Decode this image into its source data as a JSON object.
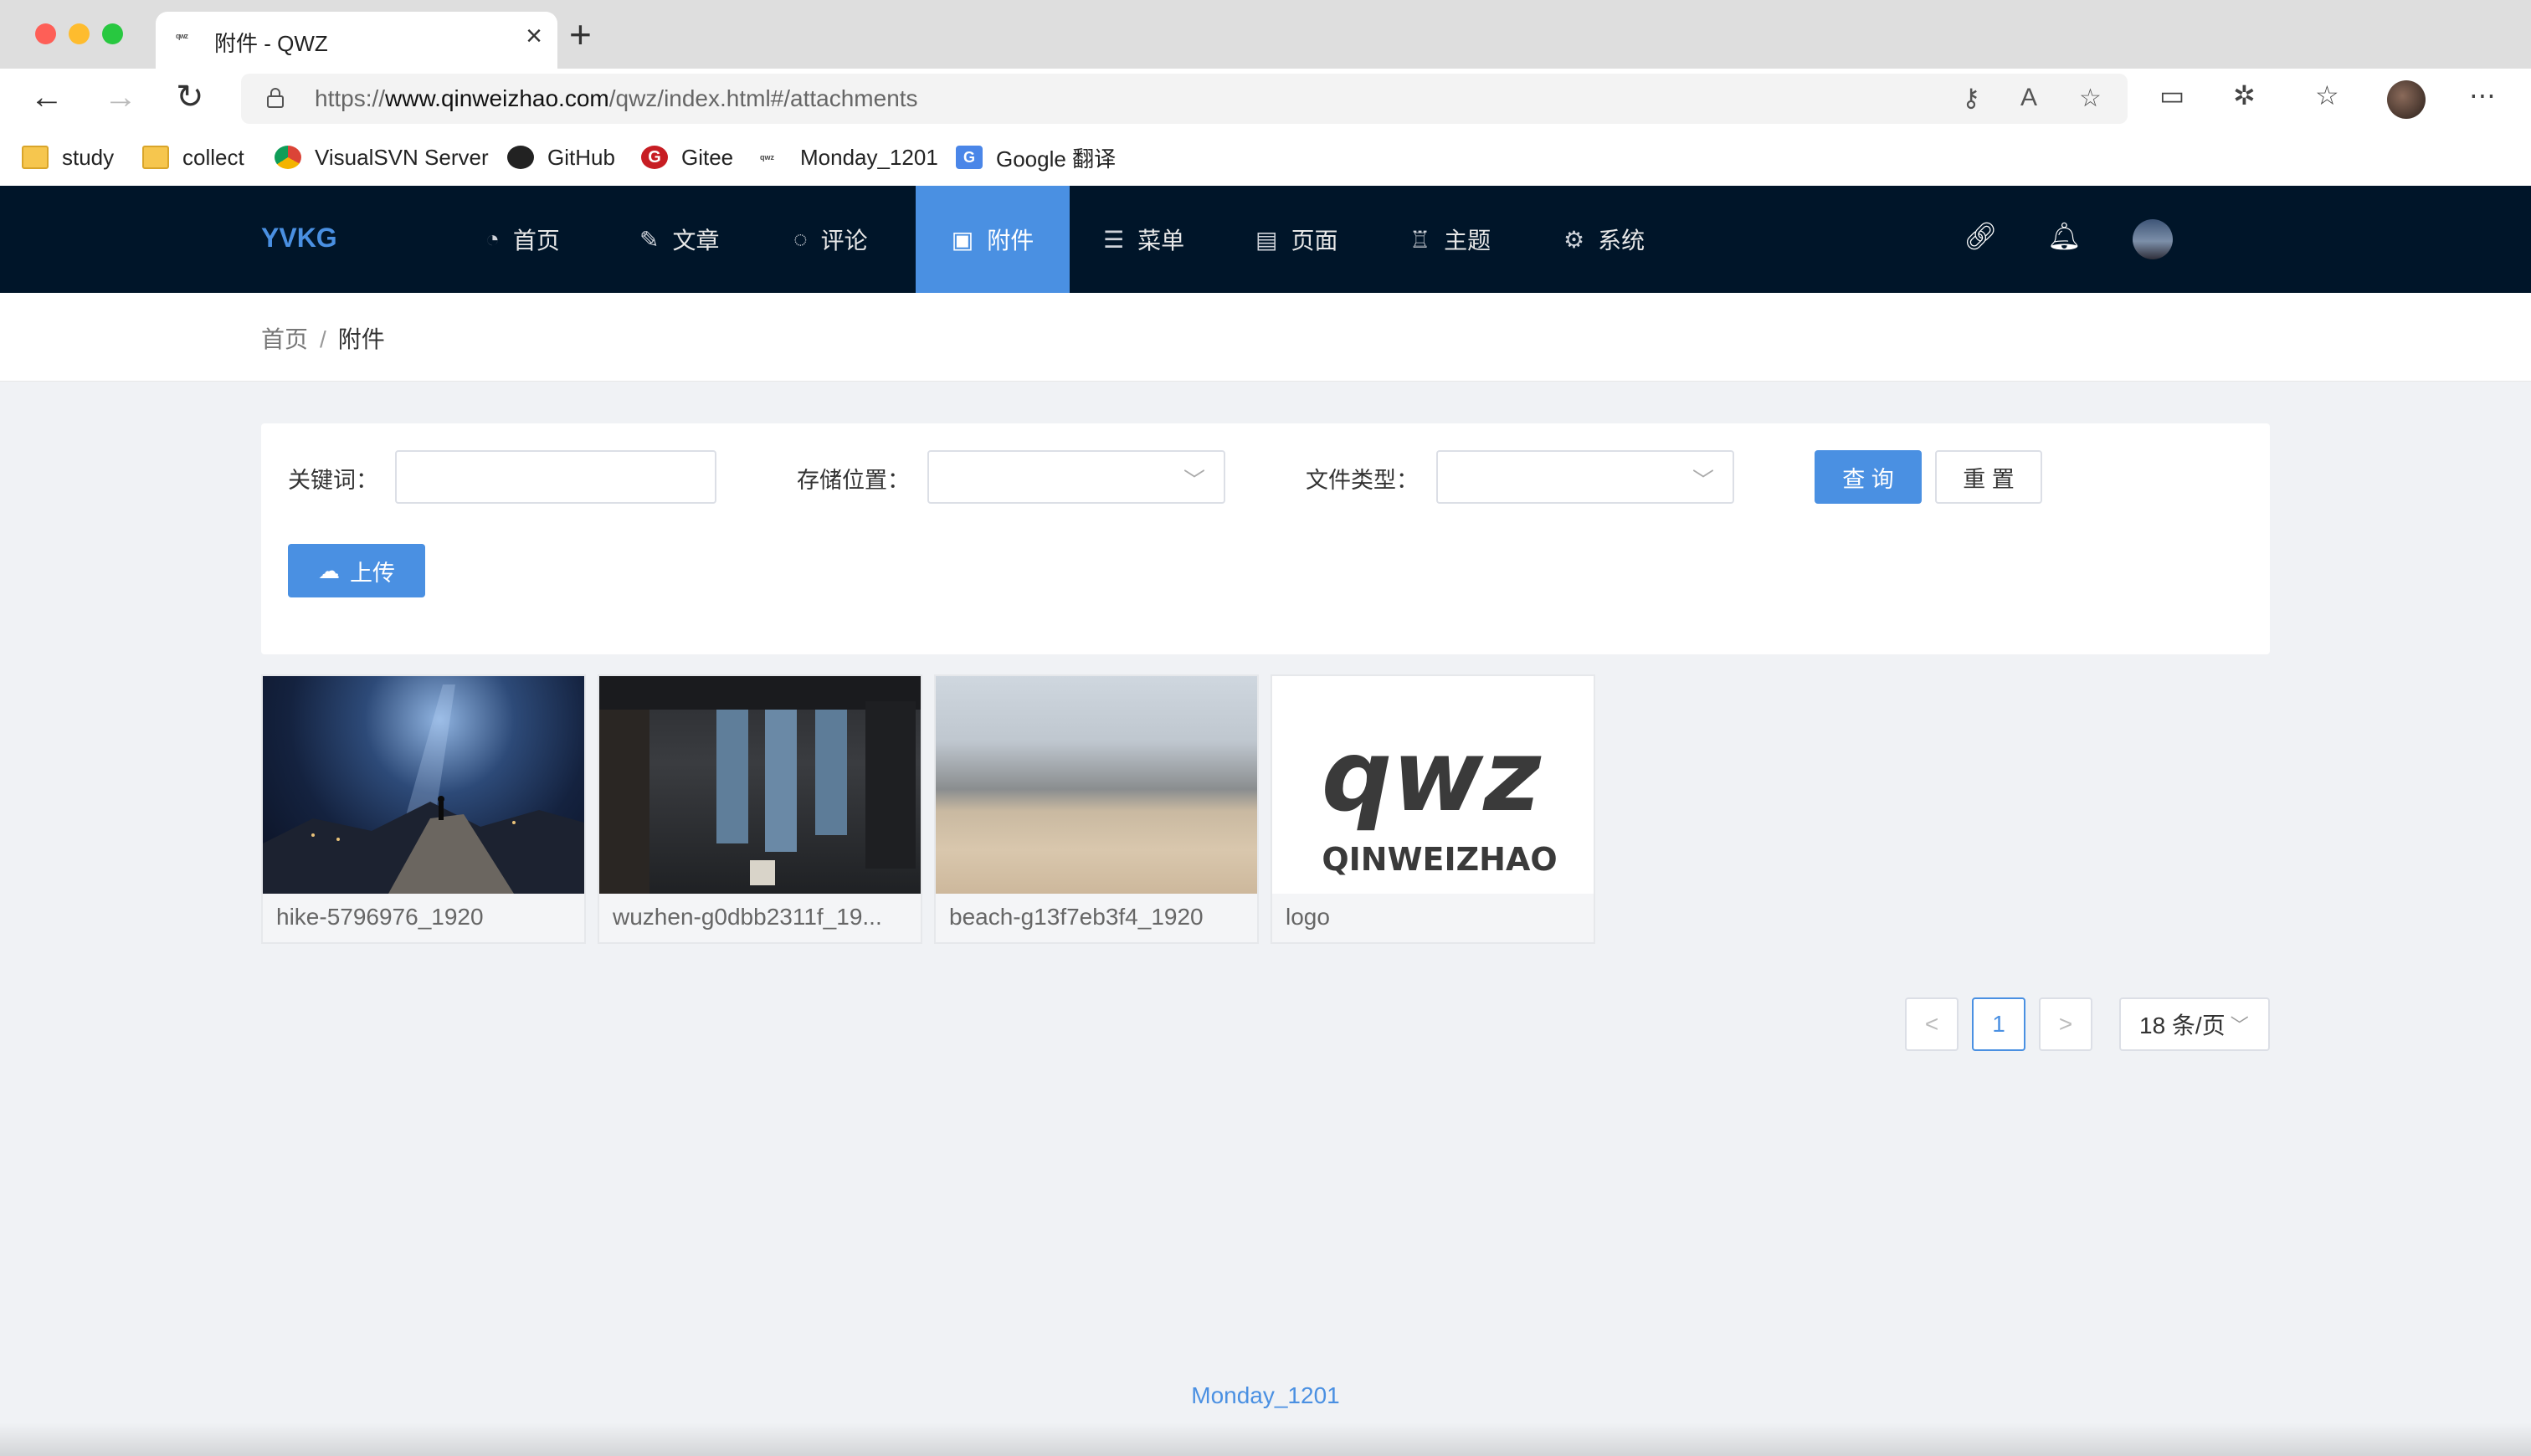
{
  "browser": {
    "tab_title": "附件 - QWZ",
    "tab_favicon": "qwz",
    "url_prefix": "https://",
    "url_host": "www.qinweizhao.com",
    "url_path": "/qwz/index.html#/attachments",
    "bookmarks": [
      {
        "label": "study",
        "icon": "folder-icon"
      },
      {
        "label": "collect",
        "icon": "folder-icon"
      },
      {
        "label": "VisualSVN Server",
        "icon": "chrome-icon"
      },
      {
        "label": "GitHub",
        "icon": "github-icon"
      },
      {
        "label": "Gitee",
        "icon": "gitee-icon"
      },
      {
        "label": "Monday_1201",
        "icon": "qwz-icon"
      },
      {
        "label": "Google 翻译",
        "icon": "google-translate-icon"
      }
    ]
  },
  "header": {
    "brand": "YVKG",
    "menu": [
      {
        "label": "首页",
        "icon": "dashboard-icon"
      },
      {
        "label": "文章",
        "icon": "edit-icon"
      },
      {
        "label": "评论",
        "icon": "comment-icon"
      },
      {
        "label": "附件",
        "icon": "picture-icon",
        "active": true
      },
      {
        "label": "菜单",
        "icon": "menu-icon"
      },
      {
        "label": "页面",
        "icon": "book-icon"
      },
      {
        "label": "主题",
        "icon": "shirt-icon"
      },
      {
        "label": "系统",
        "icon": "gear-icon"
      }
    ]
  },
  "breadcrumb": {
    "home": "首页",
    "separator": "/",
    "current": "附件"
  },
  "search": {
    "keyword_label": "关键词：",
    "keyword_value": "",
    "storage_label": "存储位置：",
    "storage_value": "",
    "filetype_label": "文件类型：",
    "filetype_value": "",
    "query_button": "查 询",
    "reset_button": "重 置",
    "upload_button": "上传"
  },
  "attachments": [
    {
      "name": "hike-5796976_1920"
    },
    {
      "name": "wuzhen-g0dbb2311f_19..."
    },
    {
      "name": "beach-g13f7eb3f4_1920"
    },
    {
      "name": "logo"
    }
  ],
  "logo_text": {
    "mark": "qwz",
    "word": "QINWEIZHAO"
  },
  "pagination": {
    "prev": "<",
    "current": "1",
    "next": ">",
    "page_size": "18 条/页"
  },
  "footer": "Monday_1201",
  "colors": {
    "header_bg": "#001529",
    "accent": "#4a90e2",
    "page_bg": "#f0f2f5"
  }
}
